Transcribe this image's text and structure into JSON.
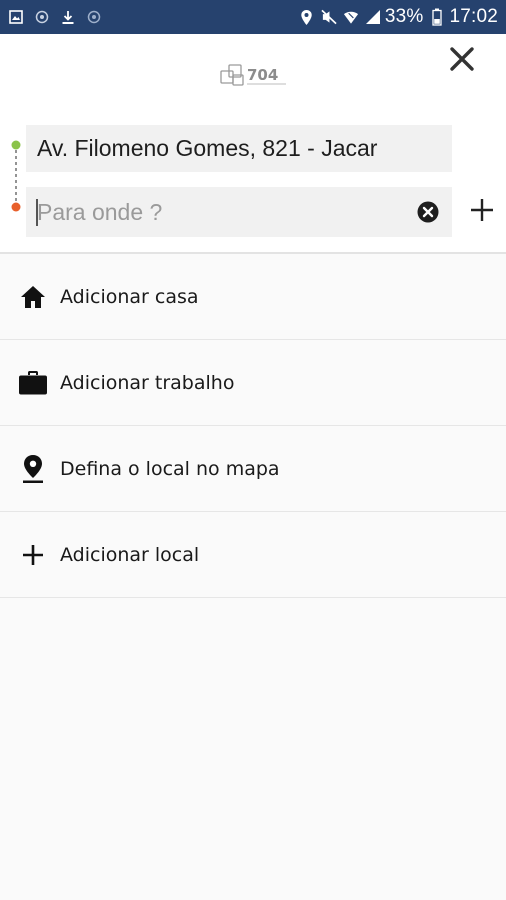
{
  "status_bar": {
    "battery_percent": "33%",
    "time": "17:02",
    "background": "#26426e",
    "left_icons": [
      "gallery-icon",
      "sync-icon",
      "download-icon",
      "sync-icon"
    ],
    "right_icons": [
      "location-icon",
      "mute-icon",
      "wifi-icon",
      "signal-icon",
      "battery-icon"
    ]
  },
  "header": {
    "logo_text": "704",
    "close_icon": "close-icon",
    "origin": "Av. Filomeno Gomes, 821 - Jacar",
    "destination_value": "",
    "destination_placeholder": "Para onde ?",
    "clear_icon": "clear-circle-icon",
    "add_stop_icon": "plus-icon",
    "origin_dot_color": "#8bc34a",
    "destination_dot_color": "#e8602c"
  },
  "list": {
    "items": [
      {
        "icon": "home-icon",
        "label": "Adicionar casa"
      },
      {
        "icon": "briefcase-icon",
        "label": "Adicionar trabalho"
      },
      {
        "icon": "map-pin-icon",
        "label": "Defina o local no mapa"
      },
      {
        "icon": "plus-icon",
        "label": "Adicionar local"
      }
    ]
  }
}
